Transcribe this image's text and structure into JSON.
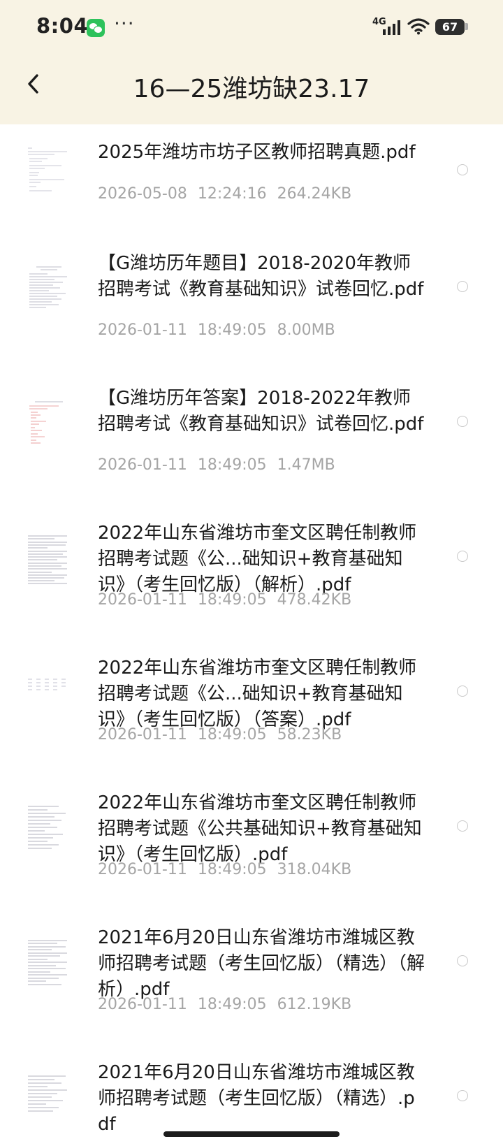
{
  "status_bar": {
    "time": "8:04",
    "more": "···",
    "network": "4G",
    "battery": "67"
  },
  "header": {
    "title": "16—25潍坊缺23.17"
  },
  "files": [
    {
      "name": "2025年潍坊市坊子区教师招聘真题.pdf",
      "date": "2026-05-08",
      "time": "12:24:16",
      "size": "264.24KB"
    },
    {
      "name": "【G潍坊历年题目】2018-2020年教师招聘考试《教育基础知识》试卷回忆.pdf",
      "date": "2026-01-11",
      "time": "18:49:05",
      "size": "8.00MB"
    },
    {
      "name": "【G潍坊历年答案】2018-2022年教师招聘考试《教育基础知识》试卷回忆.pdf",
      "date": "2026-01-11",
      "time": "18:49:05",
      "size": "1.47MB"
    },
    {
      "name": "2022年山东省潍坊市奎文区聘任制教师招聘考试题《公...础知识+教育基础知识》（考生回忆版）（解析）.pdf",
      "date": "2026-01-11",
      "time": "18:49:05",
      "size": "478.42KB"
    },
    {
      "name": "2022年山东省潍坊市奎文区聘任制教师招聘考试题《公...础知识+教育基础知识》（考生回忆版）（答案）.pdf",
      "date": "2026-01-11",
      "time": "18:49:05",
      "size": "58.23KB"
    },
    {
      "name": "2022年山东省潍坊市奎文区聘任制教师招聘考试题《公共基础知识+教育基础知识》（考生回忆版）.pdf",
      "date": "2026-01-11",
      "time": "18:49:05",
      "size": "318.04KB"
    },
    {
      "name": "2021年6月20日山东省潍坊市潍城区教师招聘考试题（考生回忆版）（精选）（解析）.pdf",
      "date": "2026-01-11",
      "time": "18:49:05",
      "size": "612.19KB"
    },
    {
      "name": "2021年6月20日山东省潍坊市潍城区教师招聘考试题（考生回忆版）（精选）.pdf",
      "date": "",
      "time": "",
      "size": ""
    }
  ],
  "icons": {
    "back": "chevron-left-icon",
    "wechat": "wechat-icon",
    "signal": "signal-icon",
    "wifi": "wifi-icon",
    "battery": "battery-icon"
  },
  "colors": {
    "header_bg": "#f8f3e4",
    "meta_text": "#a5a5a5",
    "wechat_green": "#2dc25b"
  }
}
